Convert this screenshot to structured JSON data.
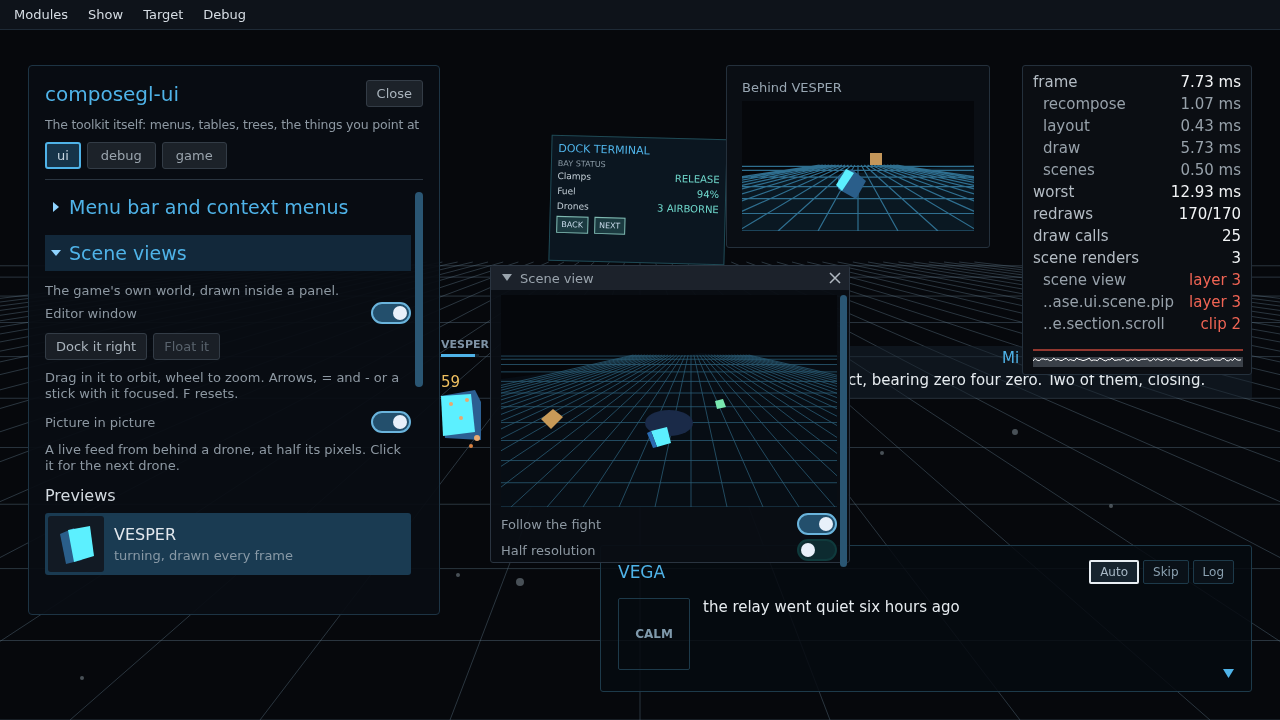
{
  "menu_bar": [
    "Modules",
    "Show",
    "Target",
    "Debug"
  ],
  "world": {
    "drone_tag": {
      "name": "VESPER",
      "value": "59",
      "level": 0.9
    },
    "dock_terminal": {
      "title": "DOCK TERMINAL",
      "subtitle": "BAY STATUS",
      "rows": [
        {
          "label": "Clamps",
          "value": "RELEASE"
        },
        {
          "label": "Fuel",
          "value": "94%"
        },
        {
          "label": "Drones",
          "value": "3 AIRBORNE"
        }
      ],
      "buttons": [
        "BACK",
        "NEXT"
      ]
    },
    "subtitle": {
      "speaker": "Mi",
      "text": "ct, bearing zero four zero. Two of them, closing."
    }
  },
  "toolkit_panel": {
    "title": "composegl-ui",
    "close_label": "Close",
    "description": "The toolkit itself: menus, tables, trees, the things you point at",
    "tabs": [
      {
        "label": "ui",
        "selected": true
      },
      {
        "label": "debug",
        "selected": false
      },
      {
        "label": "game",
        "selected": false
      }
    ],
    "sections": [
      {
        "label": "Menu bar and context menus",
        "expanded": false
      },
      {
        "label": "Scene views",
        "expanded": true
      }
    ],
    "scene_views": {
      "description": "The game's own world, drawn inside a panel.",
      "editor_window": {
        "label": "Editor window",
        "on": true
      },
      "buttons": [
        {
          "label": "Dock it right",
          "disabled": false
        },
        {
          "label": "Float it",
          "disabled": true
        }
      ],
      "hint": "Drag in it to orbit, wheel to zoom. Arrows, = and - or a stick with it focused. F resets.",
      "picture_in_picture": {
        "label": "Picture in picture",
        "on": true
      },
      "pip_description": "A live feed from behind a drone, at half its pixels. Click it for the next drone.",
      "previews_heading": "Previews",
      "previews": [
        {
          "name": "VESPER",
          "caption": "turning, drawn every frame",
          "selected": true
        }
      ]
    }
  },
  "pip_window": {
    "title": "Behind VESPER"
  },
  "scene_view_window": {
    "title": "Scene view",
    "toggles": [
      {
        "label": "Follow the fight",
        "on": true
      },
      {
        "label": "Half resolution",
        "on": false
      }
    ]
  },
  "stats": {
    "rows": [
      {
        "label": "frame",
        "value": "7.73 ms",
        "children": [
          {
            "label": "recompose",
            "value": "1.07 ms",
            "alert": false
          },
          {
            "label": "layout",
            "value": "0.43 ms",
            "alert": false
          },
          {
            "label": "draw",
            "value": "5.73 ms",
            "alert": false
          },
          {
            "label": "scenes",
            "value": "0.50 ms",
            "alert": false
          }
        ]
      },
      {
        "label": "worst",
        "value": "12.93 ms"
      },
      {
        "label": "redraws",
        "value": "170/170"
      },
      {
        "label": "draw calls",
        "value": "25"
      },
      {
        "label": "scene renders",
        "value": "3",
        "children": [
          {
            "label": "scene view",
            "value": "layer 3",
            "alert": true
          },
          {
            "label": "..ase.ui.scene.pip",
            "value": "layer 3",
            "alert": true
          },
          {
            "label": "..e.section.scroll",
            "value": "clip 2",
            "alert": true
          }
        ]
      }
    ]
  },
  "dialog": {
    "speaker": "VEGA",
    "mood": "CALM",
    "text": "the relay went quiet six hours ago",
    "buttons": [
      {
        "label": "Auto",
        "selected": true
      },
      {
        "label": "Skip",
        "selected": false
      },
      {
        "label": "Log",
        "selected": false
      }
    ]
  }
}
